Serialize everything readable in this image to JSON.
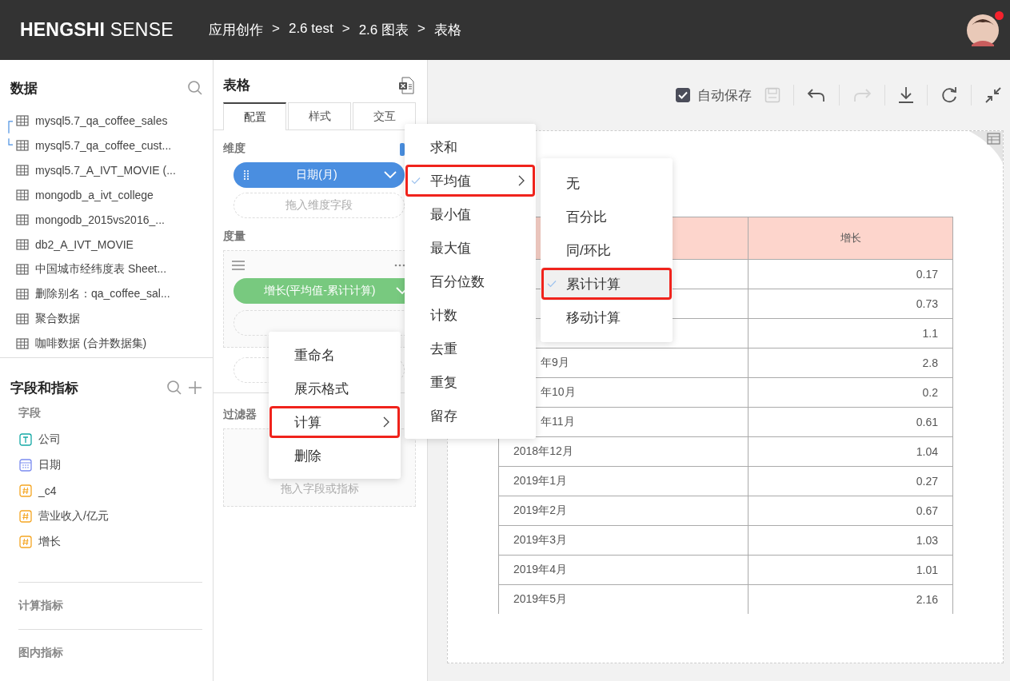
{
  "header": {
    "logo": "**HENGSHI** SENSE",
    "breadcrumb": [
      "应用创作",
      ">",
      "2.6 test",
      ">",
      "2.6 图表",
      ">",
      "表格"
    ],
    "avatar": {
      "notification": true
    }
  },
  "data_panel": {
    "title": "数据",
    "datasets": [
      {
        "name": "mysql5.7_qa_coffee_sales",
        "linked": true
      },
      {
        "name": "mysql5.7_qa_coffee_cust...",
        "linked": true
      },
      {
        "name": "mysql5.7_A_IVT_MOVIE (...",
        "linked": false
      },
      {
        "name": "mongodb_a_ivt_college",
        "linked": false
      },
      {
        "name": "mongodb_2015vs2016_...",
        "linked": false
      },
      {
        "name": "db2_A_IVT_MOVIE",
        "linked": false
      },
      {
        "name": "中国城市经纬度表 Sheet...",
        "linked": false
      },
      {
        "name": "删除别名：qa_coffee_sal...",
        "linked": false
      },
      {
        "name": "聚合数据",
        "linked": false
      },
      {
        "name": "咖啡数据 (合并数据集)",
        "linked": false
      }
    ]
  },
  "fields_panel": {
    "title": "字段和指标",
    "fields_label": "字段",
    "fields": [
      {
        "name": "公司",
        "kind": "text"
      },
      {
        "name": "日期",
        "kind": "date"
      },
      {
        "name": "_c4",
        "kind": "number"
      },
      {
        "name": "营业收入/亿元",
        "kind": "number"
      },
      {
        "name": "增长",
        "kind": "number"
      }
    ],
    "sections": [
      "计算指标",
      "图内指标"
    ]
  },
  "config_panel": {
    "title": "表格",
    "tabs": [
      {
        "label": "配置",
        "selected": true
      },
      {
        "label": "样式",
        "selected": false
      },
      {
        "label": "交互",
        "selected": false
      }
    ],
    "dimension_label": "维度",
    "dimension_pill": "日期(月)",
    "dimension_placeholder": "拖入维度字段",
    "measure_label": "度量",
    "measure_pill": "增长(平均值-累计计算)",
    "filter_label": "过滤器",
    "filter_placeholder": "拖入字段或指标"
  },
  "toolbar": {
    "autosave": {
      "label": "自动保存",
      "checked": true
    },
    "redo_disabled": true
  },
  "table": {
    "header": "增长",
    "rows": [
      {
        "value": "0.17"
      },
      {
        "value": "0.73"
      },
      {
        "value": "1.1"
      },
      {
        "date": "年9月",
        "partial": true,
        "value": "2.8"
      },
      {
        "date": "年10月",
        "partial": true,
        "value": "0.2"
      },
      {
        "date": "年11月",
        "partial": true,
        "value": "0.61"
      },
      {
        "date": "2018年12月",
        "partial": false,
        "value": "1.04"
      },
      {
        "date": "2019年1月",
        "partial": false,
        "value": "0.27"
      },
      {
        "date": "2019年2月",
        "partial": false,
        "value": "0.67"
      },
      {
        "date": "2019年3月",
        "partial": false,
        "value": "1.03"
      },
      {
        "date": "2019年4月",
        "partial": false,
        "value": "1.01"
      },
      {
        "date": "2019年5月",
        "partial": false,
        "value": "2.16"
      }
    ]
  },
  "context_menu": {
    "items": [
      {
        "label": "重命名",
        "submenu": false,
        "highlighted": false
      },
      {
        "label": "展示格式",
        "submenu": false,
        "highlighted": false
      },
      {
        "label": "计算",
        "submenu": true,
        "highlighted": true
      },
      {
        "label": "删除",
        "submenu": false,
        "highlighted": false
      }
    ]
  },
  "aggregation_menu": {
    "items": [
      {
        "label": "求和",
        "checked": false,
        "submenu": false,
        "highlighted": false
      },
      {
        "label": "平均值",
        "checked": true,
        "submenu": true,
        "highlighted": true
      },
      {
        "label": "最小值",
        "checked": false,
        "submenu": false,
        "highlighted": false
      },
      {
        "label": "最大值",
        "checked": false,
        "submenu": false,
        "highlighted": false
      },
      {
        "label": "百分位数",
        "checked": false,
        "submenu": false,
        "highlighted": false
      },
      {
        "label": "计数",
        "checked": false,
        "submenu": false,
        "highlighted": false
      },
      {
        "label": "去重",
        "checked": false,
        "submenu": false,
        "highlighted": false
      },
      {
        "label": "重复",
        "checked": false,
        "submenu": false,
        "highlighted": false
      },
      {
        "label": "留存",
        "checked": false,
        "submenu": false,
        "highlighted": false
      }
    ]
  },
  "calculation_menu": {
    "items": [
      {
        "label": "无",
        "checked": false,
        "highlighted": false
      },
      {
        "label": "百分比",
        "checked": false,
        "highlighted": false
      },
      {
        "label": "同/环比",
        "checked": false,
        "highlighted": false
      },
      {
        "label": "累计计算",
        "checked": true,
        "highlighted": true
      },
      {
        "label": "移动计算",
        "checked": false,
        "highlighted": false
      }
    ]
  }
}
